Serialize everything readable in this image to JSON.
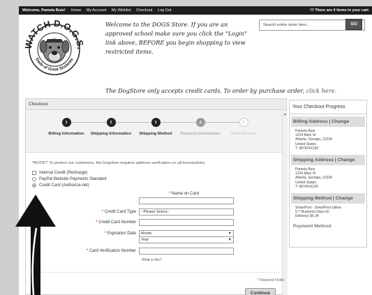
{
  "topbar": {
    "welcome": "Welcome, Pamela Buie!",
    "nav": [
      "Home",
      "My Account",
      "My Wishlist",
      "Checkout",
      "Log Out"
    ],
    "cart": "There are 4 items in your cart"
  },
  "logo": {
    "top_text": "WATCH D.O.G.S.",
    "bottom_text": "Dads of Great Students"
  },
  "welcome_lines": [
    "Welcome to the DOGS Store. If you are an",
    "approved school make sure you click the \"Login\"",
    "link above, BEFORE you begin shopping to view",
    "restricted items."
  ],
  "accept_text": "The DogStore only accepts credit cards.  To order by purchase order, ",
  "accept_link": "click here.",
  "search": {
    "placeholder": "Search entire store here...",
    "button": "GO"
  },
  "checkout": {
    "title": "Checkout",
    "steps": [
      {
        "num": "1",
        "label": "Billing Information",
        "state": "done"
      },
      {
        "num": "2",
        "label": "Shipping Information",
        "state": "done"
      },
      {
        "num": "3",
        "label": "Shipping Method",
        "state": "done"
      },
      {
        "num": "4",
        "label": "Payment Information",
        "state": "active"
      },
      {
        "num": "5",
        "label": "Order Review",
        "state": "future"
      }
    ],
    "note": "*NOTE** To protect our customers, the Dogstore requires address verification on all transactions.",
    "options": [
      "Internal Credit (Recharge)",
      "PayPal Website Payments Standard",
      "Credit Card (Authorize.net)"
    ],
    "fields": {
      "name_on_card": "Name on Card",
      "card_type": "Credit Card Type",
      "card_type_value": "--Please Select--",
      "card_number": "Credit Card Number",
      "expiration": "Expiration Date",
      "month": "Month",
      "year": "Year",
      "cvn": "Card Verification Number",
      "what_is_this": "What is this?"
    },
    "required_note": "* Required Fields",
    "continue": "Continue"
  },
  "progress": {
    "title": "Your Checkout Progress",
    "billing": {
      "head": "Billing Address | Change",
      "lines": [
        "Pamela Buie",
        "1234 Main St",
        "Atlanta, Georgia, 31234",
        "United States",
        "T: 9876541230"
      ]
    },
    "shipping": {
      "head": "Shipping Address | Change",
      "lines": [
        "Pamela Buie",
        "1234 Main St",
        "Atlanta, Georgia, 31234",
        "United States",
        "T: 9876541230"
      ]
    },
    "method": {
      "head": "Shipping Method | Change",
      "lines": [
        "SmartPost - SmartPost (allow",
        "5-7 Business Days for",
        "Delivery) $6.34"
      ]
    },
    "payment": {
      "head": "Payment Method"
    }
  },
  "colors": {
    "done": "#222222",
    "active": "#9a9a9a",
    "future": "#ffffff"
  }
}
